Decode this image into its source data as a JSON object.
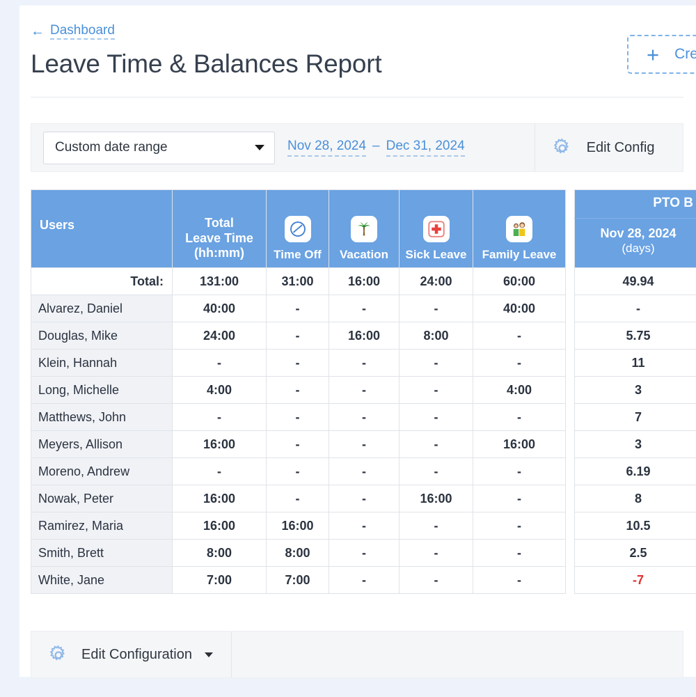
{
  "header": {
    "back_link": "Dashboard",
    "back_icon": "arrow-left-icon",
    "title": "Leave Time & Balances Report",
    "create_button": {
      "label": "Cre",
      "icon": "plus-icon"
    }
  },
  "filter_bar": {
    "range_select": {
      "value": "Custom date range",
      "icon": "chevron-down-icon"
    },
    "date_from": "Nov 28, 2024",
    "date_separator": "–",
    "date_to": "Dec 31, 2024",
    "edit_config": {
      "label": "Edit Config",
      "icon": "gear-icon"
    }
  },
  "leave_table": {
    "columns": [
      {
        "key": "users",
        "label": "Users",
        "icon": null
      },
      {
        "key": "total",
        "label": "Total\nLeave Time\n(hh:mm)",
        "line1": "Total",
        "line2": "Leave Time",
        "line3": "(hh:mm)",
        "icon": null
      },
      {
        "key": "timeoff",
        "label": "Time Off",
        "icon": "no-entry-icon"
      },
      {
        "key": "vacation",
        "label": "Vacation",
        "icon": "palm-tree-icon"
      },
      {
        "key": "sick",
        "label": "Sick Leave",
        "icon": "medical-cross-icon"
      },
      {
        "key": "family",
        "label": "Family Leave",
        "icon": "family-icon"
      }
    ],
    "total_row": {
      "label": "Total:",
      "total": "131:00",
      "timeoff": "31:00",
      "vacation": "16:00",
      "sick": "24:00",
      "family": "60:00"
    },
    "rows": [
      {
        "name": "Alvarez, Daniel",
        "total": "40:00",
        "timeoff": "-",
        "vacation": "-",
        "sick": "-",
        "family": "40:00"
      },
      {
        "name": "Douglas, Mike",
        "total": "24:00",
        "timeoff": "-",
        "vacation": "16:00",
        "sick": "8:00",
        "family": "-"
      },
      {
        "name": "Klein, Hannah",
        "total": "-",
        "timeoff": "-",
        "vacation": "-",
        "sick": "-",
        "family": "-"
      },
      {
        "name": "Long, Michelle",
        "total": "4:00",
        "timeoff": "-",
        "vacation": "-",
        "sick": "-",
        "family": "4:00"
      },
      {
        "name": "Matthews, John",
        "total": "-",
        "timeoff": "-",
        "vacation": "-",
        "sick": "-",
        "family": "-"
      },
      {
        "name": "Meyers, Allison",
        "total": "16:00",
        "timeoff": "-",
        "vacation": "-",
        "sick": "-",
        "family": "16:00"
      },
      {
        "name": "Moreno, Andrew",
        "total": "-",
        "timeoff": "-",
        "vacation": "-",
        "sick": "-",
        "family": "-"
      },
      {
        "name": "Nowak, Peter",
        "total": "16:00",
        "timeoff": "-",
        "vacation": "-",
        "sick": "16:00",
        "family": "-"
      },
      {
        "name": "Ramirez, Maria",
        "total": "16:00",
        "timeoff": "16:00",
        "vacation": "-",
        "sick": "-",
        "family": "-"
      },
      {
        "name": "Smith, Brett",
        "total": "8:00",
        "timeoff": "8:00",
        "vacation": "-",
        "sick": "-",
        "family": "-"
      },
      {
        "name": "White, Jane",
        "total": "7:00",
        "timeoff": "7:00",
        "vacation": "-",
        "sick": "-",
        "family": "-"
      }
    ]
  },
  "pto_table": {
    "group_header": "PTO B",
    "sub_header_date": "Nov 28, 2024",
    "sub_header_unit": "(days)",
    "total_value": "49.94",
    "values": [
      "-",
      "5.75",
      "11",
      "3",
      "7",
      "3",
      "6.19",
      "8",
      "10.5",
      "2.5",
      "-7"
    ],
    "negative_color": "#e03131"
  },
  "footer": {
    "edit_config": {
      "label": "Edit Configuration",
      "icon": "gear-icon",
      "caret": "caret-down-icon"
    }
  },
  "theme": {
    "header_blue": "#6aa2e2",
    "link_blue": "#4a90d9",
    "page_bg": "#eef3fb",
    "row_name_bg": "#f0f2f6",
    "bar_bg": "#f5f6f8"
  }
}
